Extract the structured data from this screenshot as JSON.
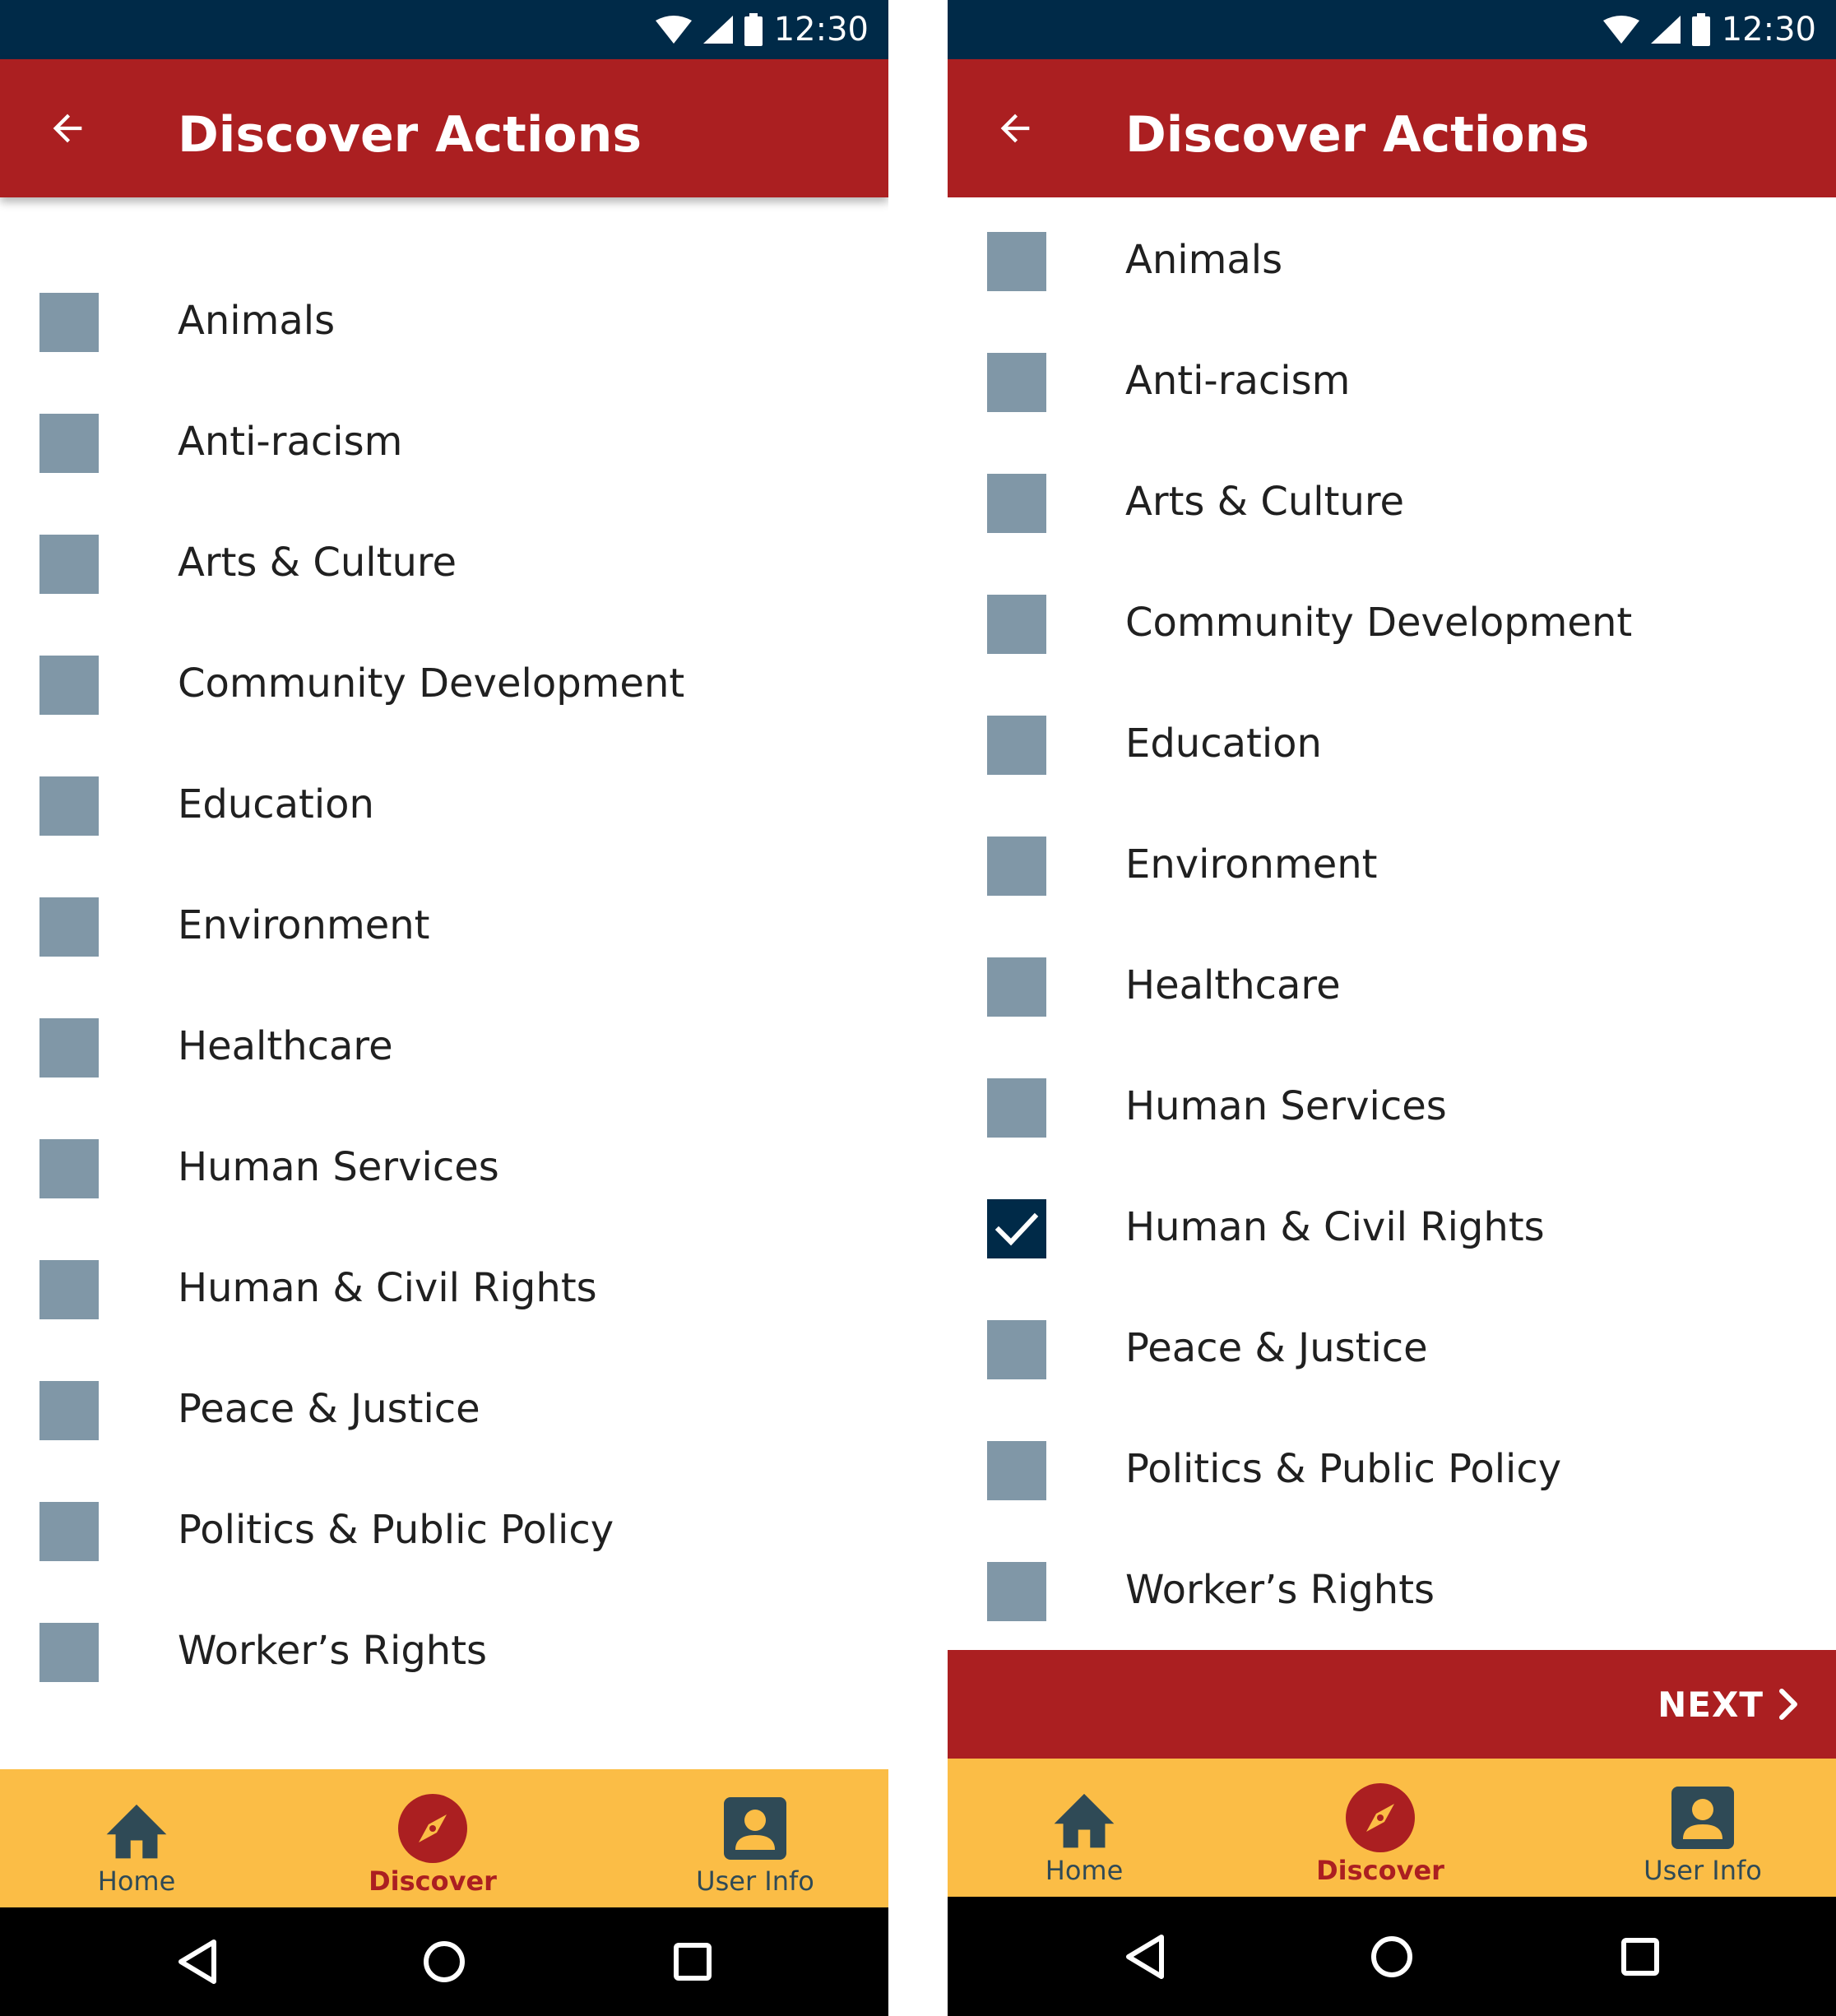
{
  "colors": {
    "status_bar": "#002a48",
    "app_bar": "#ab1f21",
    "checkbox_unchecked": "#8097a7",
    "checkbox_checked": "#002a48",
    "bottom_nav": "#fbbd46",
    "accent": "#ab1f21",
    "nav_icon": "#2f4a56"
  },
  "status": {
    "time": "12:30",
    "icons": [
      "wifi-icon",
      "cell-signal-icon",
      "battery-icon"
    ]
  },
  "app_bar": {
    "title": "Discover Actions",
    "back_icon": "arrow-left-icon"
  },
  "screens": [
    {
      "categories": [
        {
          "label": "Animals",
          "checked": false
        },
        {
          "label": "Anti-racism",
          "checked": false
        },
        {
          "label": "Arts & Culture",
          "checked": false
        },
        {
          "label": "Community Development",
          "checked": false
        },
        {
          "label": "Education",
          "checked": false
        },
        {
          "label": "Environment",
          "checked": false
        },
        {
          "label": "Healthcare",
          "checked": false
        },
        {
          "label": "Human Services",
          "checked": false
        },
        {
          "label": "Human & Civil Rights",
          "checked": false
        },
        {
          "label": "Peace & Justice",
          "checked": false
        },
        {
          "label": "Politics & Public Policy",
          "checked": false
        },
        {
          "label": "Worker’s Rights",
          "checked": false
        }
      ]
    },
    {
      "categories": [
        {
          "label": "Animals",
          "checked": false
        },
        {
          "label": "Anti-racism",
          "checked": false
        },
        {
          "label": "Arts & Culture",
          "checked": false
        },
        {
          "label": "Community Development",
          "checked": false
        },
        {
          "label": "Education",
          "checked": false
        },
        {
          "label": "Environment",
          "checked": false
        },
        {
          "label": "Healthcare",
          "checked": false
        },
        {
          "label": "Human Services",
          "checked": false
        },
        {
          "label": "Human & Civil Rights",
          "checked": true
        },
        {
          "label": "Peace & Justice",
          "checked": false
        },
        {
          "label": "Politics & Public Policy",
          "checked": false
        },
        {
          "label": "Worker’s Rights",
          "checked": false
        }
      ],
      "next_button": {
        "label": "NEXT",
        "icon": "chevron-right-icon"
      }
    }
  ],
  "bottom_nav": {
    "items": [
      {
        "label": "Home",
        "icon": "home-icon",
        "active": false
      },
      {
        "label": "Discover",
        "icon": "compass-icon",
        "active": true
      },
      {
        "label": "User Info",
        "icon": "user-icon",
        "active": false
      }
    ]
  },
  "system_nav": {
    "icons": [
      "back-triangle-icon",
      "home-circle-icon",
      "recents-square-icon"
    ]
  }
}
